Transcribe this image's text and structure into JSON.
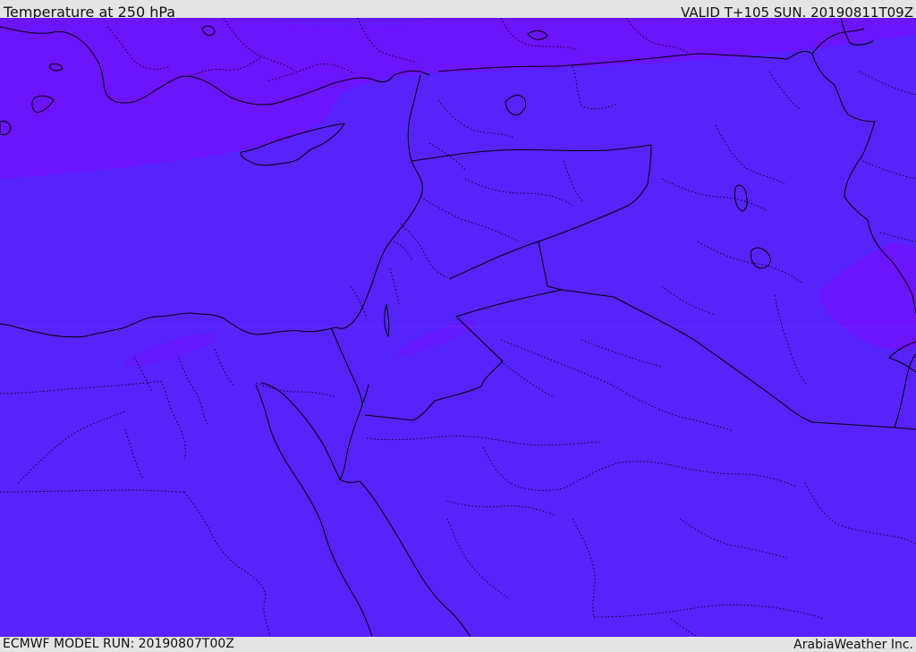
{
  "header": {
    "title": "Temperature at 250 hPa",
    "valid": "VALID T+105 SUN. 20190811T09Z"
  },
  "footer": {
    "model_run": "ECMWF MODEL RUN: 20190807T00Z",
    "credit": "ArabiaWeather Inc."
  },
  "colors": {
    "field_main": "#5623fd",
    "field_warm": "#6c14fc",
    "field_warm_edge": "#6419fc",
    "border_line": "#000000",
    "frame_bg": "#e4e4e4"
  }
}
